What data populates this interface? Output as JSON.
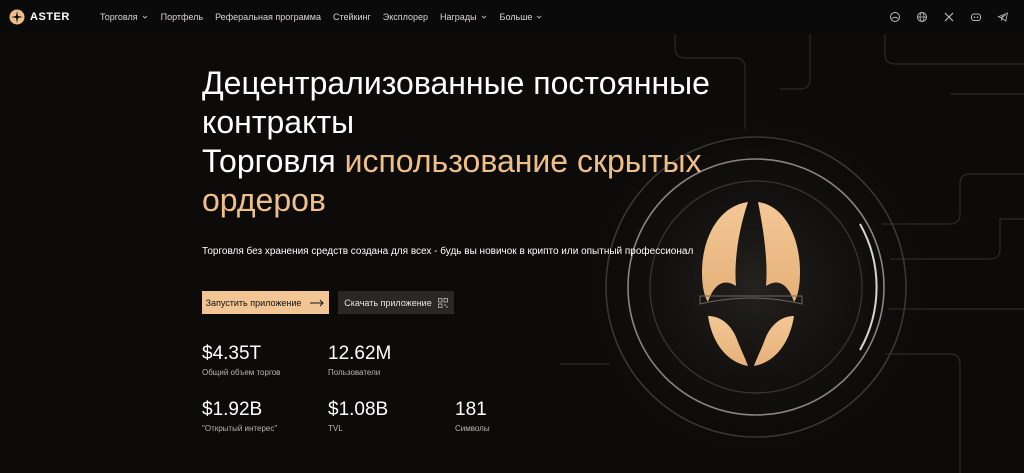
{
  "brand": {
    "name": "ASTER",
    "accent": "#efbf8a"
  },
  "nav": {
    "items": [
      {
        "label": "Торговля",
        "dropdown": true
      },
      {
        "label": "Портфель",
        "dropdown": false
      },
      {
        "label": "Реферальная программа",
        "dropdown": false
      },
      {
        "label": "Стейкинг",
        "dropdown": false
      },
      {
        "label": "Эксплорер",
        "dropdown": false
      },
      {
        "label": "Награды",
        "dropdown": true
      },
      {
        "label": "Больше",
        "dropdown": true
      }
    ],
    "icons": [
      "theme-icon",
      "globe-icon",
      "x-icon",
      "discord-icon",
      "telegram-icon"
    ]
  },
  "hero": {
    "line1": "Децентрализованные постоянные",
    "line2": "контракты",
    "line3_plain": "Торговля",
    "line3_accent": "использование скрытых",
    "line4_accent": "ордеров",
    "subtitle": "Торговля без хранения средств создана для всех - будь вы новичок в крипто или опытный профессионал"
  },
  "buttons": {
    "launch": "Запустить приложение",
    "download": "Скачать приложение"
  },
  "stats": [
    {
      "value": "$4.35T",
      "label": "Общий объем торгов"
    },
    {
      "value": "12.62M",
      "label": "Пользователи"
    },
    {
      "value": "$1.92B",
      "label": "\"Открытый интерес\""
    },
    {
      "value": "$1.08B",
      "label": "TVL"
    },
    {
      "value": "181",
      "label": "Символы"
    }
  ]
}
